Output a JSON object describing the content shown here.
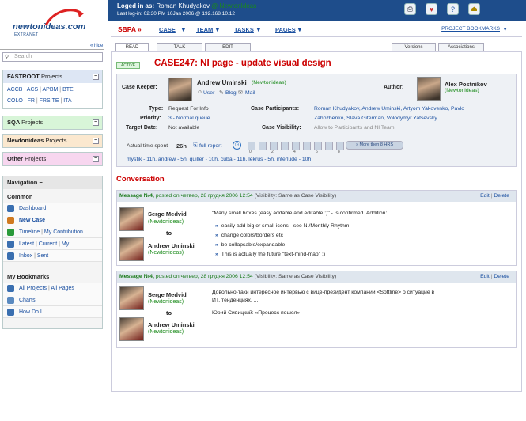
{
  "header": {
    "logged_in_label": "Loged in as:",
    "user": "Roman Khudyakov",
    "at": "@",
    "org": "NewtonIdeas",
    "last_login": "Last log-in: 02:30 PM 10Jan 2006 @ 192.168.10.12",
    "icons": [
      "print-icon",
      "favorite-icon",
      "help-icon",
      "exit-icon"
    ]
  },
  "logo": {
    "brand": "newtonideas.com",
    "sub": "EXTRANET"
  },
  "sidebar": {
    "hide": "« hide",
    "search_placeholder": "Search",
    "fastroot": {
      "title": "FASTROOT",
      "suffix": "Projects",
      "links": [
        "ACCB",
        "ACS",
        "APBM",
        "BTE",
        "COLO",
        "FR",
        "FRSITE",
        "ITA"
      ],
      "color": "#dde6f4"
    },
    "sqa": {
      "title": "SQA",
      "suffix": "Projects",
      "color": "#d8f5d8"
    },
    "newtonideas": {
      "title": "Newtonideas",
      "suffix": "Projects",
      "color": "#fbe8cf"
    },
    "other": {
      "title": "Other",
      "suffix": "Projects",
      "color": "#f7d6ef"
    },
    "toggle": "−",
    "navigation": {
      "title": "Navigation",
      "common": "Common",
      "items": [
        {
          "name": "dashboard",
          "parts": [
            "Dashboard"
          ],
          "bold": false,
          "color": "#3a6fb0"
        },
        {
          "name": "new-case",
          "parts": [
            "New Case"
          ],
          "bold": true,
          "color": "#d07a20"
        },
        {
          "name": "timeline",
          "parts": [
            "Timeline",
            "My Contribution"
          ],
          "bold": false,
          "color": "#2a9a3a"
        },
        {
          "name": "latest",
          "parts": [
            "Latest",
            "Current",
            "My"
          ],
          "bold": false,
          "color": "#3a6fb0"
        },
        {
          "name": "inbox",
          "parts": [
            "Inbox",
            "Sent"
          ],
          "bold": false,
          "color": "#3a6fb0"
        }
      ],
      "bookmarks": "My Bookmarks",
      "bookmark_items": [
        {
          "name": "all-projects",
          "parts": [
            "All Projects",
            "All Pages"
          ],
          "color": "#3a6fb0"
        },
        {
          "name": "charts",
          "parts": [
            "Charts"
          ],
          "color": "#5a8ac0"
        },
        {
          "name": "how-do-i",
          "parts": [
            "How Do I..."
          ],
          "color": "#3a6fb0"
        }
      ]
    }
  },
  "mainnav": {
    "project": "SBPA »",
    "items": [
      "CASE",
      "TEAM",
      "TASKS",
      "PAGES"
    ],
    "bookmarks": "PROJECT BOOKMARKS"
  },
  "tabs": {
    "left": [
      "READ",
      "TALK",
      "EDIT"
    ],
    "right": [
      "Versions",
      "Associations"
    ]
  },
  "case": {
    "status": "ACTIVE",
    "title": "CASE247: NI page - update visual design",
    "keeper_label": "Case Keeper:",
    "keeper_name": "Andrew Uminski",
    "keeper_org": "(Newtonideas)",
    "keeper_links": [
      "User",
      "Blog",
      "Mail"
    ],
    "author_label": "Author:",
    "author_name": "Alex Postnikov",
    "author_org": "(Newtonideas)",
    "type_label": "Type:",
    "type": "Request For Info",
    "priority_label": "Priority:",
    "priority": "3 - Normal queue",
    "target_label": "Target Date:",
    "target": "Not available",
    "participants_label": "Case Participants:",
    "participants_1": "Roman Khudyakov, Andrew Uminski, Artyom Yakovenko, Pavlo",
    "participants_2": "Zahozhenko, Slava Giterman, Volodymyr Yatsevsky",
    "visibility_label": "Case Visibility:",
    "visibility": "Allow to Participants and NI Team",
    "time_label": "Actual time spent -",
    "time_value": "26h",
    "full_report": "full report",
    "more_hrs": "More then 8 HRS",
    "time_ticks": [
      "0",
      "2",
      "4",
      "6",
      "8"
    ],
    "time_breakdown": "mystik - 11h, andrew - 5h, quiller - 10h, cuba - 11h, lekrus - 5h, interlude - 10h"
  },
  "conversation": {
    "title": "Conversation",
    "messages": [
      {
        "label": "Message №4,",
        "posted": "posted on четвер, 28 грудня 2006 12:54",
        "visibility": "(Visibility: Same as Case Visibility)",
        "edit": "Edit",
        "delete": "Delete",
        "from": "Serge Medvid",
        "from_org": "(Newtonideas)",
        "to_label": "to",
        "to": "Andrew Uminski",
        "to_org": "(Newtonideas)",
        "text": "\"Many small boxes (easy addable and editable :)\" - is confirmed. Addition:",
        "bullets": [
          "easily add big or small icons - see NI/Monthly Rhythm",
          "change colors/borders etc",
          "be collapsable/expandable",
          "This is actually the future \"text-mind-map\" :)"
        ]
      },
      {
        "label": "Message №4,",
        "posted": "posted on четвер, 28 грудня 2006 12:54",
        "visibility": "(Visibility: Same as Case Visibility)",
        "edit": "Edit",
        "delete": "Delete",
        "from": "Serge Medvid",
        "from_org": "(Newtonideas)",
        "to_label": "to",
        "to": "Andrew Uminski",
        "to_org": "(Newtonideas)",
        "text_1": "Довольно-таки интересное интервью с вице-президент компании <Softline> о ситуацие в",
        "text_2": "ИТ, тенденциях, ...",
        "link": "Юрий Сивицкий: «Процесс пошел»"
      }
    ]
  }
}
